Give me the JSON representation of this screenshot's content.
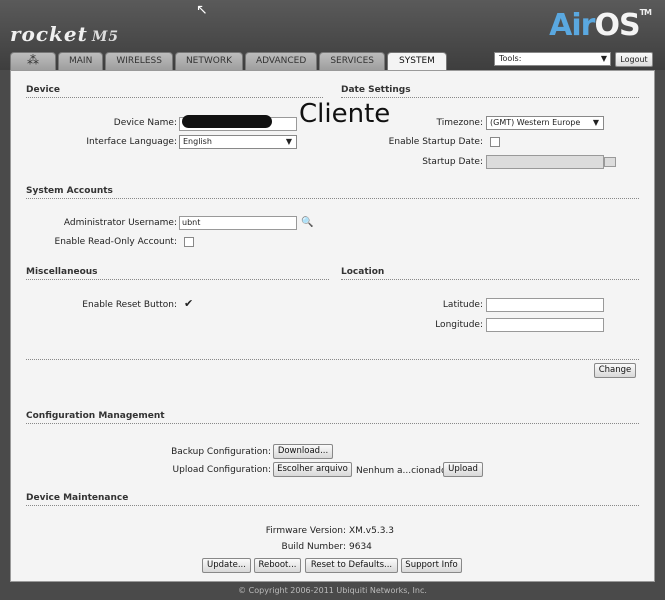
{
  "header": {
    "brand": "rocket",
    "model": "M5",
    "airos_air": "Air",
    "airos_os": "OS",
    "airos_tm": "TM",
    "tabs": [
      "MAIN",
      "WIRELESS",
      "NETWORK",
      "ADVANCED",
      "SERVICES",
      "SYSTEM"
    ],
    "active_tab": "SYSTEM",
    "tools_label": "Tools:",
    "logout_label": "Logout"
  },
  "device": {
    "title": "Device",
    "name_label": "Device Name:",
    "name_overlay": "Cliente",
    "lang_label": "Interface Language:",
    "lang_value": "English"
  },
  "date": {
    "title": "Date Settings",
    "timezone_label": "Timezone:",
    "timezone_value": "(GMT) Western Europe",
    "startup_enable_label": "Enable Startup Date:",
    "startup_date_label": "Startup Date:"
  },
  "accounts": {
    "title": "System Accounts",
    "admin_label": "Administrator Username:",
    "admin_value": "ubnt",
    "readonly_label": "Enable Read-Only Account:"
  },
  "misc": {
    "title": "Miscellaneous",
    "reset_label": "Enable Reset Button:",
    "reset_checked": true
  },
  "location": {
    "title": "Location",
    "latitude_label": "Latitude:",
    "longitude_label": "Longitude:"
  },
  "actions": {
    "change_label": "Change"
  },
  "config": {
    "title": "Configuration Management",
    "backup_label": "Backup Configuration:",
    "download_label": "Download...",
    "upload_label": "Upload Configuration:",
    "choose_label": "Escolher arquivo",
    "no_file_text": "Nenhum a...cionado",
    "upload_btn_label": "Upload"
  },
  "maintenance": {
    "title": "Device Maintenance",
    "firmware_label": "Firmware Version:",
    "firmware_value": "XM.v5.3.3",
    "build_label": "Build Number:",
    "build_value": "9634",
    "update_label": "Update...",
    "reboot_label": "Reboot...",
    "reset_defaults_label": "Reset to Defaults...",
    "support_label": "Support Info"
  },
  "footer": {
    "copyright": "© Copyright 2006-2011 Ubiquiti Networks, Inc."
  }
}
